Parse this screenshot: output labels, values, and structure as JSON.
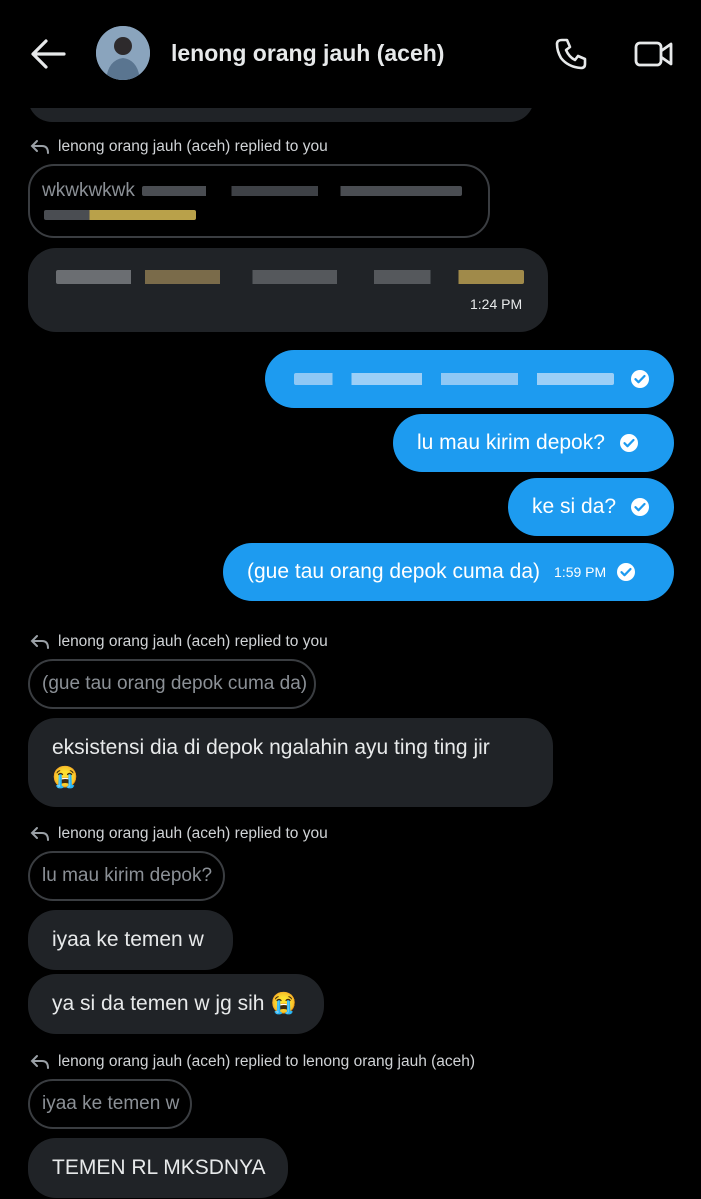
{
  "header": {
    "back_icon": "arrow-left-icon",
    "title": "lenong orang jauh (aceh)",
    "call_icon": "phone-icon",
    "video_icon": "video-camera-icon"
  },
  "colors": {
    "background": "#000000",
    "incoming_bubble": "#202327",
    "outgoing_bubble": "#1d9bf0"
  },
  "messages": {
    "reply1": {
      "meta": "lenong orang jauh (aceh) replied to you",
      "quote": "wkwkwkwk",
      "time": "1:24 PM"
    },
    "out": {
      "m2": "lu mau kirim depok?",
      "m3": "ke si da?",
      "m4": "(gue tau orang depok cuma da)",
      "m4_time": "1:59 PM"
    },
    "reply2": {
      "meta": "lenong orang jauh (aceh) replied to you",
      "quote": "(gue tau orang depok cuma da)",
      "text_line1": "eksistensi dia di depok ngalahin ayu ting ting jir",
      "emoji": "😭"
    },
    "reply3": {
      "meta": "lenong orang jauh (aceh) replied to you",
      "quote": "lu mau kirim depok?",
      "text1": "iyaa ke temen w",
      "text2": "ya si da temen w jg sih",
      "emoji": "😭"
    },
    "reply4": {
      "meta": "lenong orang jauh (aceh) replied to lenong orang jauh (aceh)",
      "quote": "iyaa ke temen w",
      "text": "TEMEN RL MKSDNYA"
    }
  }
}
